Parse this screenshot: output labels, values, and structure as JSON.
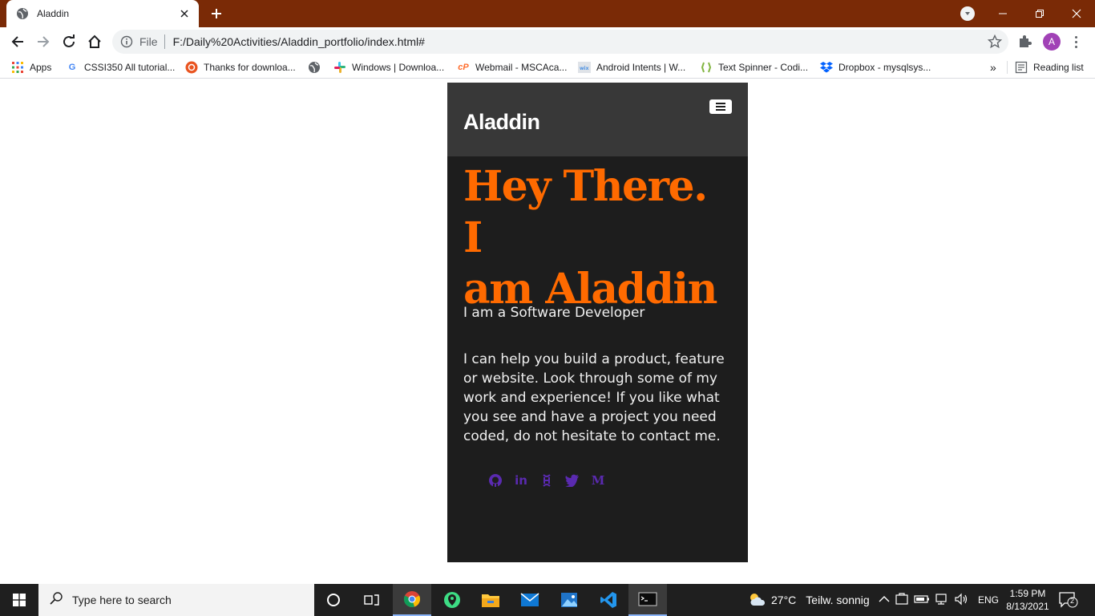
{
  "browser": {
    "tab_title": "Aladdin",
    "omnibox_scheme": "File",
    "url": "F:/Daily%20Activities/Aladdin_portfolio/index.html#",
    "profile_initial": "A",
    "bookmarks": [
      {
        "label": "Apps",
        "icon": "apps-grid-icon"
      },
      {
        "label": "CSSI350 All tutorial...",
        "icon": "google-icon"
      },
      {
        "label": "Thanks for downloa...",
        "icon": "ubuntu-icon"
      },
      {
        "label": "",
        "icon": "globe-icon"
      },
      {
        "label": "Windows | Downloa...",
        "icon": "slack-icon"
      },
      {
        "label": "Webmail - MSCAca...",
        "icon": "cpanel-icon"
      },
      {
        "label": "Android Intents | W...",
        "icon": "wix-icon"
      },
      {
        "label": "Text Spinner - Codi...",
        "icon": "codecanyon-icon"
      },
      {
        "label": "Dropbox - mysqlsys...",
        "icon": "dropbox-icon"
      }
    ],
    "more_bookmarks": "»",
    "reading_list": "Reading list"
  },
  "site": {
    "brand": "Aladdin",
    "hero_line1": "Hey There. I",
    "hero_line2": "am Aladdin",
    "role": "I am a Software Developer",
    "description": "I can help you build a product, feature or website. Look through some of my work and experience! If you like what you see and have a project you need coded, do not hesitate to contact me.",
    "socials": [
      "github-icon",
      "linkedin-icon",
      "hackerrank-icon",
      "twitter-icon",
      "medium-icon"
    ],
    "accent_color": "#ff6a00",
    "social_color": "#5a2ab0"
  },
  "taskbar": {
    "search_placeholder": "Type here to search",
    "weather_temp": "27°C",
    "weather_text": "Teilw. sonnig",
    "lang": "ENG",
    "time": "1:59 PM",
    "date": "8/13/2021",
    "notification_count": "2"
  }
}
